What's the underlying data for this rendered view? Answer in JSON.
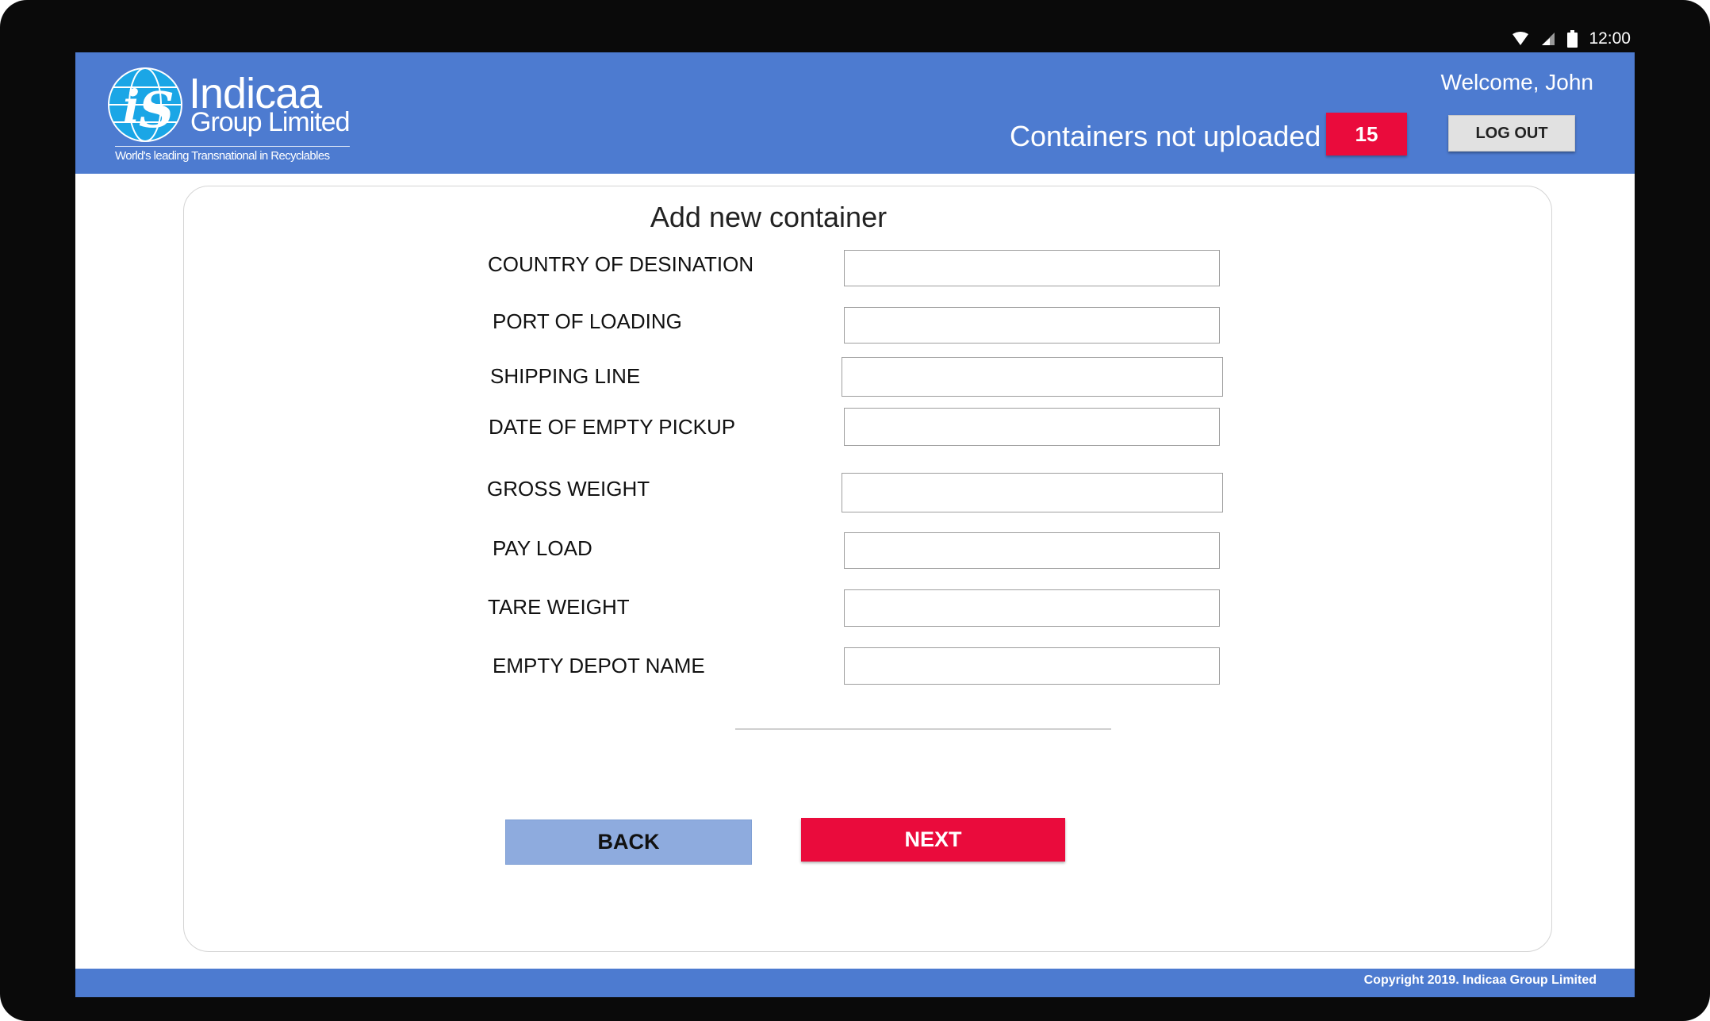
{
  "status_bar": {
    "time": "12:00",
    "icons": [
      "wifi-icon",
      "signal-icon",
      "battery-icon"
    ]
  },
  "header": {
    "logo": {
      "name": "Indicaa",
      "subtitle": "Group Limited",
      "tagline": "World's leading Transnational in Recyclables"
    },
    "welcome": "Welcome, John",
    "containers_label": "Containers not uploaded",
    "containers_count": "15",
    "logout_label": "LOG OUT"
  },
  "form": {
    "title": "Add new container",
    "fields": [
      {
        "label": "COUNTRY OF DESINATION",
        "value": ""
      },
      {
        "label": "PORT OF LOADING",
        "value": ""
      },
      {
        "label": "SHIPPING LINE",
        "value": ""
      },
      {
        "label": "DATE OF EMPTY PICKUP",
        "value": ""
      },
      {
        "label": "GROSS WEIGHT",
        "value": ""
      },
      {
        "label": "PAY LOAD",
        "value": ""
      },
      {
        "label": "TARE WEIGHT",
        "value": ""
      },
      {
        "label": "EMPTY DEPOT NAME",
        "value": ""
      }
    ],
    "back_label": "BACK",
    "next_label": "NEXT"
  },
  "footer": {
    "copyright": "Copyright 2019. Indicaa Group Limited"
  },
  "colors": {
    "brand_blue": "#4d7bd0",
    "alert_red": "#ea0b3c",
    "back_button": "#8eabde"
  }
}
